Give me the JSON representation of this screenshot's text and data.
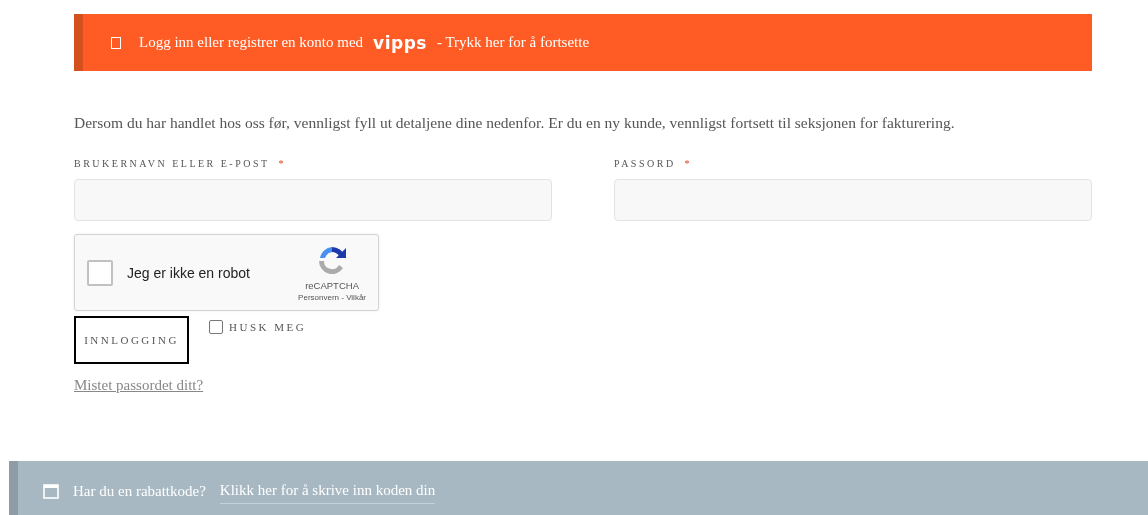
{
  "vipps_notice": {
    "before": "Logg inn eller registrer en konto med",
    "logo": "vipps",
    "after": "- Trykk her for å fortsette"
  },
  "intro": "Dersom du har handlet hos oss før, vennligst fyll ut detaljene dine nedenfor. Er du en ny kunde, vennligst fortsett til seksjonen for fakturering.",
  "fields": [
    {
      "label": "BRUKERNAVN ELLER E-POST",
      "required": "*"
    },
    {
      "label": "PASSORD",
      "required": "*"
    }
  ],
  "recaptcha": {
    "label": "Jeg er ikke en robot",
    "checked": false,
    "brand": "reCAPTCHA",
    "links": "Personvern - Vilkår"
  },
  "login_button": "INNLOGGING",
  "remember": {
    "label": "HUSK MEG",
    "checked": false
  },
  "lost_password": "Mistet passordet ditt?",
  "coupon": {
    "question": "Har du en rabattkode?",
    "link": "Klikk her for å skrive inn koden din"
  }
}
